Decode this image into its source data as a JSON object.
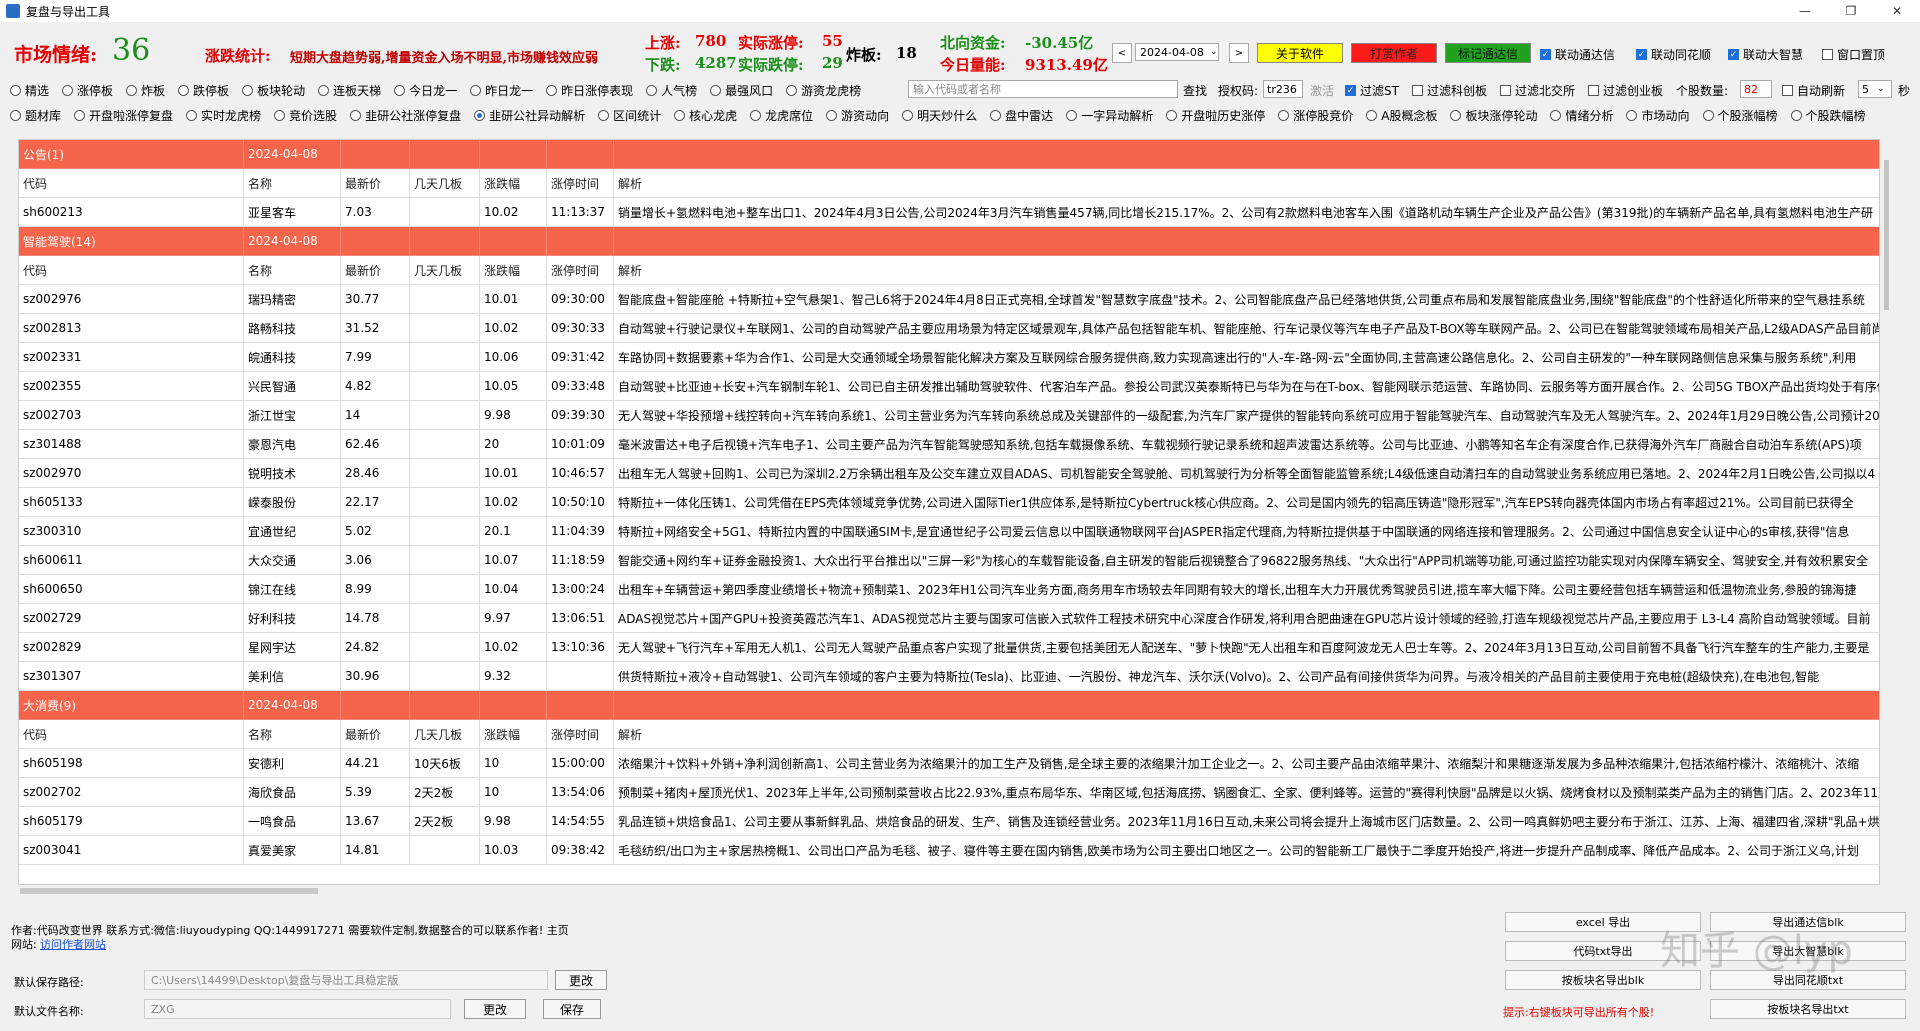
{
  "window": {
    "title": "复盘与导出工具"
  },
  "header": {
    "sentiment_label": "市场情绪:",
    "sentiment_value": "36",
    "stats_label": "涨跌统计:",
    "stats_text": "短期大盘趋势弱,增量资金入场不明显,市场赚钱效应弱",
    "up_label": "上涨:",
    "up_value": "780",
    "down_label": "下跌:",
    "down_value": "4287",
    "limit_up_label": "实际涨停:",
    "limit_up_value": "55",
    "limit_down_label": "实际跌停:",
    "limit_down_value": "29",
    "broken_label": "炸板:",
    "broken_value": "18",
    "north_label": "北向资金:",
    "north_value": "-30.45亿",
    "volume_label": "今日量能:",
    "volume_value": "9313.49亿",
    "date": "2024-04-08",
    "prev": "<",
    "next": ">",
    "btn_about": "关于软件",
    "btn_donate": "打赏作者",
    "btn_remember": "标记通达信",
    "chk_link_tdx": "联动通达信",
    "chk_link_ths": "联动同花顺",
    "chk_link_dzh": "联动大智慧",
    "chk_topmost": "窗口置顶"
  },
  "filters": {
    "row1": [
      "精选",
      "涨停板",
      "炸板",
      "跌停板",
      "板块轮动",
      "连板天梯",
      "今日龙一",
      "昨日龙一",
      "昨日涨停表现",
      "人气榜",
      "最强风口",
      "游资龙虎榜"
    ],
    "search_placeholder": "输入代码或者名称",
    "search_btn": "查找",
    "auth_label": "授权码:",
    "auth_value": "tr236",
    "activate": "激活",
    "chk_st": "过滤ST",
    "chk_kcb": "过滤科创板",
    "chk_bjs": "过滤北交所",
    "chk_cyb": "过滤创业板",
    "count_label": "个股数量:",
    "count_value": "82",
    "auto_refresh": "自动刷新",
    "interval": "5",
    "sec": "秒",
    "row2": [
      "题材库",
      "开盘啦涨停复盘",
      "实时龙虎榜",
      "竞价选股",
      "韭研公社涨停复盘",
      "韭研公社异动解析",
      "区间统计",
      "核心龙虎",
      "龙虎席位",
      "游资动向",
      "明天炒什么",
      "盘中雷达",
      "一字异动解析",
      "开盘啦历史涨停",
      "涨停股竞价",
      "A股概念板",
      "板块涨停轮动",
      "情绪分析",
      "市场动向",
      "个股涨幅榜",
      "个股跌幅榜"
    ]
  },
  "table": {
    "headers": [
      "代码",
      "名称",
      "最新价",
      "几天几板",
      "涨跌幅",
      "涨停时间",
      "解析"
    ],
    "groups": [
      {
        "name": "公告(1)",
        "date": "2024-04-08",
        "rows": [
          [
            "sh600213",
            "亚星客车",
            "7.03",
            "",
            "10.02",
            "11:13:37",
            "销量增长+氢燃料电池+整车出口1、2024年4月3日公告,公司2024年3月汽车销售量457辆,同比增长215.17%。2、公司有2款燃料电池客车入围《道路机动车辆生产企业及产品公告》(第319批)的车辆新产品名单,具有氢燃料电池生产研"
          ]
        ]
      },
      {
        "name": "智能驾驶(14)",
        "date": "2024-04-08",
        "rows": [
          [
            "sz002976",
            "瑞玛精密",
            "30.77",
            "",
            "10.01",
            "09:30:00",
            "智能底盘+智能座舱 +特斯拉+空气悬架1、智己L6将于2024年4月8日正式亮相,全球首发\"智慧数字底盘\"技术。2、公司智能底盘产品已经落地供货,公司重点布局和发展智能底盘业务,围绕\"智能底盘\"的个性舒适化所带来的空气悬挂系统"
          ],
          [
            "sz002813",
            "路畅科技",
            "31.52",
            "",
            "10.02",
            "09:30:33",
            "自动驾驶+行驶记录仪+车联网1、公司的自动驾驶产品主要应用场景为特定区域景观车,具体产品包括智能车机、智能座舱、行车记录仪等汽车电子产品及T-BOX等车联网产品。2、公司已在智能驾驶领域布局相关产品,L2级ADAS产品目前尚"
          ],
          [
            "sz002331",
            "皖通科技",
            "7.99",
            "",
            "10.06",
            "09:31:42",
            "车路协同+数据要素+华为合作1、公司是大交通领域全场景智能化解决方案及互联网综合服务提供商,致力实现高速出行的\"人-车-路-网-云\"全面协同,主营高速公路信息化。2、公司自主研发的\"一种车联网路侧信息采集与服务系统\",利用"
          ],
          [
            "sz002355",
            "兴民智通",
            "4.82",
            "",
            "10.05",
            "09:33:48",
            "自动驾驶+比亚迪+长安+汽车钢制车轮1、公司已自主研发推出辅助驾驶软件、代客泊车产品。参投公司武汉英泰斯特已与华为在与在T-box、智能网联示范运营、车路协同、云服务等方面开展合作。2、公司5G TBOX产品出货均处于有序供货"
          ],
          [
            "sz002703",
            "浙江世宝",
            "14",
            "",
            "9.98",
            "09:39:30",
            "无人驾驶+华投预增+线控转向+汽车转向系统1、公司主营业务为汽车转向系统总成及关键部件的一级配套,为汽车厂家产提供的智能转向系统可应用于智能驾驶汽车、自动驾驶汽车及无人驾驶汽车。2、2024年1月29日晚公告,公司预计2023年"
          ],
          [
            "sz301488",
            "豪恩汽电",
            "62.46",
            "",
            "20",
            "10:01:09",
            "毫米波雷达+电子后视镜+汽车电子1、公司主要产品为汽车智能驾驶感知系统,包括车载摄像系统、车载视频行驶记录系统和超声波雷达系统等。公司与比亚迪、小鹏等知名车企有深度合作,已获得海外汽车厂商融合自动泊车系统(APS)项"
          ],
          [
            "sz002970",
            "锐明技术",
            "28.46",
            "",
            "10.01",
            "10:46:57",
            "出租车无人驾驶+回购1、公司已为深圳2.2万余辆出租车及公交车建立双目ADAS、司机智能安全驾驶舱、司机驾驶行为分析等全面智能监管系统;L4级低速自动清扫车的自动驾驶业务系统应用已落地。2、2024年2月1日晚公告,公司拟以4"
          ],
          [
            "sh605133",
            "嵘泰股份",
            "22.17",
            "",
            "10.02",
            "10:50:10",
            "特斯拉+一体化压铸1、公司凭借在EPS壳体领域竞争优势,公司进入国际Tier1供应体系,是特斯拉Cybertruck核心供应商。2、公司是国内领先的铝高压铸造\"隐形冠军\",汽车EPS转向器壳体国内市场占有率超过21%。公司目前已获得全"
          ],
          [
            "sz300310",
            "宜通世纪",
            "5.02",
            "",
            "20.1",
            "11:04:39",
            "特斯拉+网络安全+5G1、特斯拉内置的中国联通SIM卡,是宜通世纪子公司爱云信息以中国联通物联网平台JASPER指定代理商,为特斯拉提供基于中国联通的网络连接和管理服务。2、公司通过中国信息安全认证中心的s审核,获得\"信息"
          ],
          [
            "sh600611",
            "大众交通",
            "3.06",
            "",
            "10.07",
            "11:18:59",
            "智能交通+网约车+证券金融投资1、大众出行平台推出以\"三屏一彩\"为核心的车载智能设备,自主研发的智能后视镜整合了96822服务热线、\"大众出行\"APP司机端等功能,可通过监控功能实现对内保障车辆安全、驾驶安全,并有效积累安全"
          ],
          [
            "sh600650",
            "锦江在线",
            "8.99",
            "",
            "10.04",
            "13:00:24",
            "出租车+车辆营运+第四季度业绩增长+物流+预制菜1、2023年H1公司汽车业务方面,商务用车市场较去年同期有较大的增长,出租车大力开展优秀驾驶员引进,揽车率大幅下降。公司主要经营包括车辆营运和低温物流业务,参股的锦海捷"
          ],
          [
            "sz002729",
            "好利科技",
            "14.78",
            "",
            "9.97",
            "13:06:51",
            "ADAS视觉芯片+国产GPU+投资英霞芯汽车1、ADAS视觉芯片主要与国家可信嵌入式软件工程技术研究中心深度合作研发,将利用合肥曲速在GPU芯片设计领域的经验,打造车规级视觉芯片产品,主要应用于 L3-L4 高阶自动驾驶领域。目前"
          ],
          [
            "sz002829",
            "星网宇达",
            "24.82",
            "",
            "10.02",
            "13:10:36",
            "无人驾驶+飞行汽车+军用无人机1、公司无人驾驶产品重点客户实现了批量供货,主要包括美团无人配送车、\"萝卜快跑\"无人出租车和百度阿波龙无人巴士车等。2、2024年3月13日互动,公司目前暂不具备飞行汽车整车的生产能力,主要是"
          ],
          [
            "sz301307",
            "美利信",
            "30.96",
            "",
            "9.32",
            "",
            "供货特斯拉+液冷+自动驾驶1、公司汽车领域的客户主要为特斯拉(Tesla)、比亚迪、一汽股份、神龙汽车、沃尔沃(Volvo)。2、公司产品有间接供货华为问界。与液冷相关的产品目前主要使用于充电桩(超级快充),在电池包,智能"
          ]
        ]
      },
      {
        "name": "大消费(9)",
        "date": "2024-04-08",
        "rows": [
          [
            "sh605198",
            "安德利",
            "44.21",
            "10天6板",
            "10",
            "15:00:00",
            "浓缩果汁+饮料+外销+净利润创新高1、公司主营业务为浓缩果汁的加工生产及销售,是全球主要的浓缩果汁加工企业之一。2、公司主要产品由浓缩苹果汁、浓缩梨汁和果糖逐渐发展为多品种浓缩果汁,包括浓缩柠檬汁、浓缩桃汁、浓缩"
          ],
          [
            "sz002702",
            "海欣食品",
            "5.39",
            "2天2板",
            "10",
            "13:54:06",
            "预制菜+猪肉+屋顶光伏1、2023年上半年,公司预制菜营收占比22.93%,重点布局华东、华南区域,包括海底捞、锅圈食汇、全家、便利蜂等。运营的\"赛得利快厨\"品牌是以火锅、烧烤食材以及预制菜类产品为主的销售门店。2、2023年11月2日互动公"
          ],
          [
            "sh605179",
            "一鸣食品",
            "13.67",
            "2天2板",
            "9.98",
            "14:54:55",
            "乳品连锁+烘焙食品1、公司主要从事新鲜乳品、烘焙食品的研发、生产、销售及连锁经营业务。2023年11月16日互动,未来公司将会提升上海城市区门店数量。2、公司一鸣真鲜奶吧主要分布于浙江、江苏、上海、福建四省,深耕\"乳品+烘"
          ],
          [
            "sz003041",
            "真爱美家",
            "14.81",
            "",
            "10.03",
            "09:38:42",
            "毛毯纺织/出口为主+家居热榜概1、公司出口产品为毛毯、被子、寝件等主要在国内销售,欧美市场为公司主要出口地区之一。公司的智能新工厂最快于二季度开始投产,将进一步提升产品制成率、降低产品成本。2、公司于浙江义乌,计划"
          ]
        ]
      }
    ]
  },
  "footer": {
    "author": "作者:代码改变世界 联系方式:微信:liuyoudyping QQ:1449917271 需要软件定制,数据整合的可以联系作者! 主页",
    "site_label": "网站:",
    "site_link": "访问作者网站",
    "save_path_label": "默认保存路径:",
    "save_path_value": "C:\\Users\\14499\\Desktop\\复盘与导出工具稳定版",
    "change1": "更改",
    "file_name_label": "默认文件名称:",
    "file_name_value": "ZXG",
    "change2": "更改",
    "save": "保存",
    "excel_export": "excel 导出",
    "export_tdx_blk": "导出通达信blk",
    "code_txt_export": "代码txt导出",
    "export_dzh": "导出大智慧blk",
    "export_sector_blk": "按板块名导出blk",
    "export_ths_txt": "导出同花顺txt",
    "hint": "提示:右键板块可导出所有个股!",
    "export_sector_txt": "按板块名导出txt",
    "watermark": "知乎 @lyp"
  },
  "colors": {
    "group_bg": "#f6644b",
    "accent": "#1e6fd9",
    "up": "#e60000",
    "down": "#1a8f1a"
  }
}
